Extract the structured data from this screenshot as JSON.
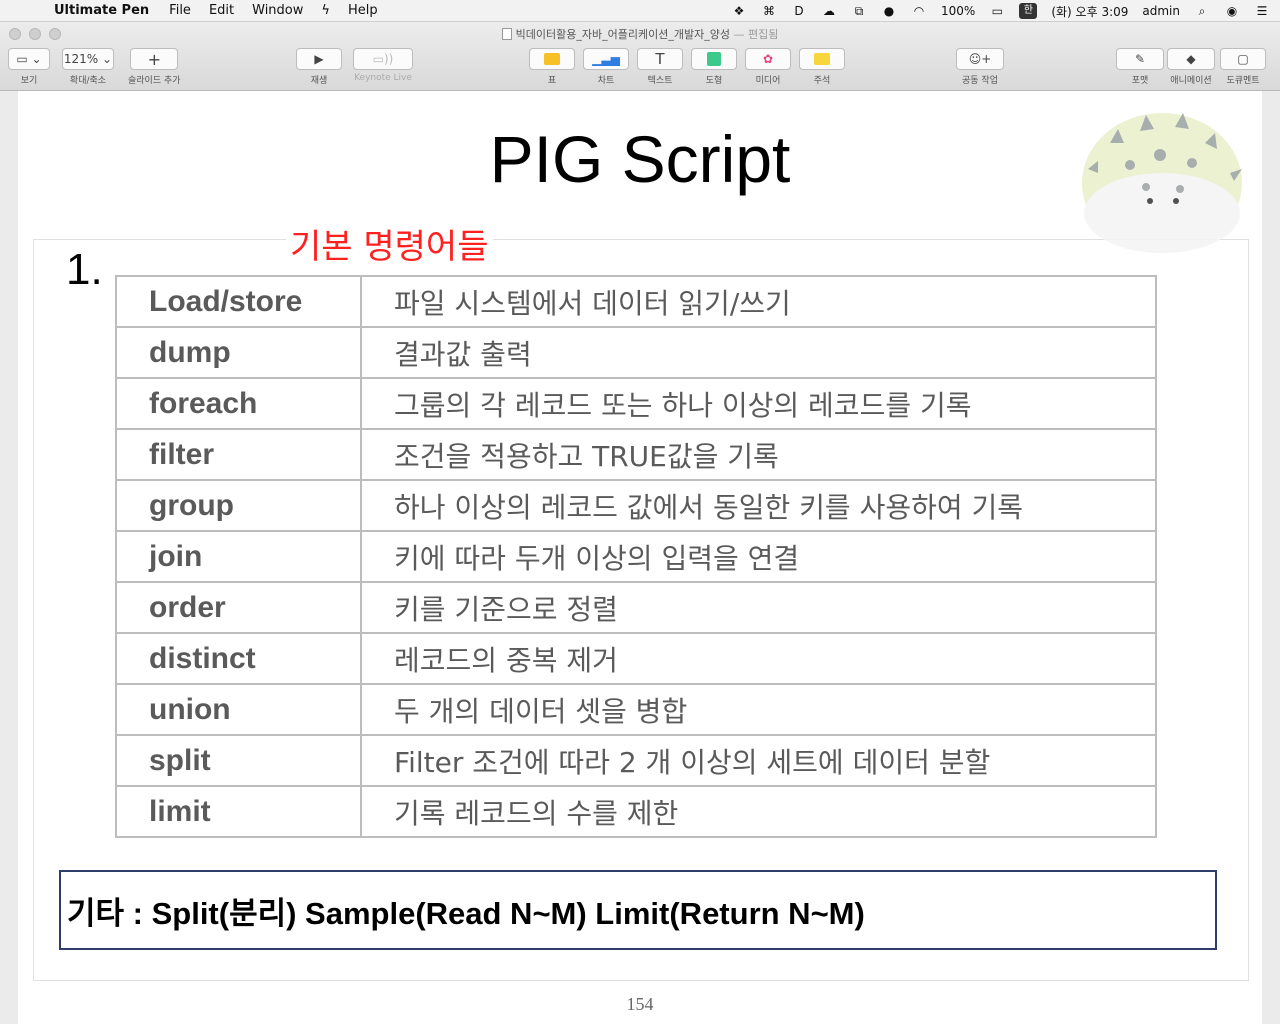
{
  "menubar": {
    "app_name": "Ultimate Pen",
    "items": [
      "File",
      "Edit",
      "Window",
      "Help"
    ],
    "battery": "100%",
    "ime": "한",
    "clock": "(화) 오후 3:09",
    "user": "admin"
  },
  "window": {
    "doc_title": "빅데이터활용_자바_어플리케이션_개발자_양성",
    "doc_status": "— 편집됨"
  },
  "toolbar": {
    "view_label": "보기",
    "zoom_value": "121%",
    "zoom_label": "확대/축소",
    "add_slide_label": "슬라이드 추가",
    "play_label": "재생",
    "keynote_live_label": "Keynote Live",
    "table_label": "표",
    "chart_label": "차트",
    "text_label": "텍스트",
    "shape_label": "도형",
    "media_label": "미디어",
    "comment_label": "주석",
    "collab_label": "공동 작업",
    "format_label": "포맷",
    "animate_label": "애니메이션",
    "document_label": "도큐멘트"
  },
  "slide": {
    "title": "PIG Script",
    "subtitle": "기본 명령어들",
    "number": "1.",
    "commands": [
      {
        "name": "Load/store",
        "desc": "파일 시스템에서 데이터 읽기/쓰기"
      },
      {
        "name": "dump",
        "desc": "결과값 출력"
      },
      {
        "name": "foreach",
        "desc": "그룹의 각 레코드 또는 하나 이상의 레코드를 기록"
      },
      {
        "name": "filter",
        "desc": "조건을 적용하고 TRUE값을 기록"
      },
      {
        "name": "group",
        "desc": "하나 이상의 레코드 값에서 동일한 키를 사용하여 기록"
      },
      {
        "name": "join",
        "desc": "키에 따라 두개 이상의 입력을 연결"
      },
      {
        "name": "order",
        "desc": "키를 기준으로 정렬"
      },
      {
        "name": "distinct",
        "desc": "레코드의 중복 제거"
      },
      {
        "name": "union",
        "desc": "두 개의 데이터 셋을 병합"
      },
      {
        "name": "split",
        "desc": "Filter 조건에 따라 2 개 이상의 세트에 데이터 분할"
      },
      {
        "name": "limit",
        "desc": "기록 레코드의 수를 제한"
      }
    ],
    "note": "기타 : Split(분리) Sample(Read N~M) Limit(Return N~M)",
    "page_number": "154"
  },
  "colors": {
    "subtitle": "#ff2020",
    "note_border": "#2f3d6b",
    "table_border": "#bdbdbd",
    "table_text": "#5a5a5a"
  }
}
